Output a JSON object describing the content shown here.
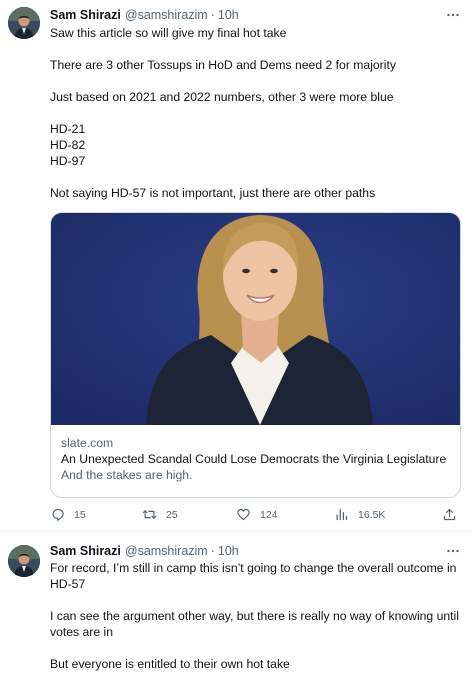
{
  "tweet1": {
    "author": {
      "name": "Sam Shirazi",
      "handle": "@samshirazim",
      "separator": "·",
      "time": "10h"
    },
    "lines": [
      "Saw this article so will give my final hot take",
      "There are 3 other Tossups in HoD and Dems need 2 for majority",
      "Just based on 2021 and 2022 numbers, other 3 were more blue",
      "HD-21",
      "HD-82",
      "HD-97",
      "Not saying HD-57 is not important, just there are other paths"
    ],
    "card": {
      "domain": "slate.com",
      "title": "An Unexpected Scandal Could Lose Democrats the Virginia Legislature",
      "description": "And the stakes are high."
    },
    "actions": {
      "replies": "15",
      "reposts": "25",
      "likes": "124",
      "views": "16.5K"
    }
  },
  "tweet2": {
    "author": {
      "name": "Sam Shirazi",
      "handle": "@samshirazim",
      "separator": "·",
      "time": "10h"
    },
    "lines": [
      "For record, I’m still in camp this isn’t going to change the overall outcome in HD-57",
      "I can see the argument other way, but there is really no way of knowing until votes are in",
      "But everyone is entitled to their own hot take"
    ]
  },
  "icons": [
    "avatar",
    "more-icon",
    "reply-icon",
    "repost-icon",
    "like-icon",
    "views-icon",
    "share-icon"
  ],
  "colors": {
    "text": "#0f1419",
    "secondary": "#536471",
    "border": "#cfd9de",
    "card_background": "#223272"
  }
}
